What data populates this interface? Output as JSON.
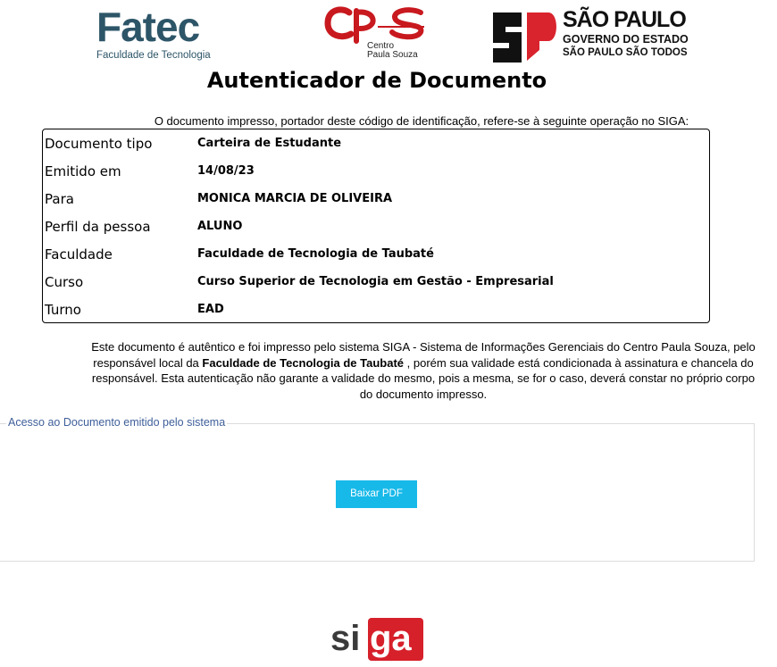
{
  "header": {
    "fatec_logo": {
      "name": "Fatec",
      "subtitle": "Faculdade de Tecnologia"
    },
    "cps_logo": {
      "mark": "cps",
      "line1": "Centro",
      "line2": "Paula Souza",
      "color": "#c8191f"
    },
    "sp_logo": {
      "line1": "SÃO PAULO",
      "line2": "GOVERNO DO ESTADO",
      "line3": "SÃO PAULO SÃO TODOS",
      "accent": "#d9232d"
    }
  },
  "title": "Autenticador de Documento",
  "intro": "O documento impresso, portador deste código de identificação, refere-se à seguinte operação no SIGA:",
  "details": [
    {
      "label": "Documento tipo",
      "value": "Carteira de Estudante"
    },
    {
      "label": "Emitido em",
      "value": "14/08/23"
    },
    {
      "label": "Para",
      "value": "MONICA MARCIA DE OLIVEIRA"
    },
    {
      "label": "Perfil da pessoa",
      "value": "ALUNO"
    },
    {
      "label": "Faculdade",
      "value": "Faculdade de Tecnologia de Taubaté"
    },
    {
      "label": "Curso",
      "value": "Curso Superior de Tecnologia em Gestão - Empresarial"
    },
    {
      "label": "Turno",
      "value": "EAD"
    }
  ],
  "note": {
    "part1": "Este documento é autêntico e foi impresso pelo sistema SIGA - Sistema de Informações Gerenciais do Centro Paula Souza, pelo responsável local da ",
    "bold": "Faculdade de Tecnologia de Taubaté",
    "part2": " , porém sua validade está condicionada à assinatura e chancela do responsável. Esta autenticação não garante a validade do mesmo, pois a mesma, se for o caso, deverá constar no próprio corpo do documento impresso."
  },
  "access": {
    "legend": "Acesso ao Documento emitido pelo sistema",
    "button_label": "Baixar PDF",
    "button_color": "#17b9e9"
  },
  "footer": {
    "siga_logo": {
      "prefix": "si",
      "highlight": "ga",
      "accent": "#d6202a"
    }
  }
}
